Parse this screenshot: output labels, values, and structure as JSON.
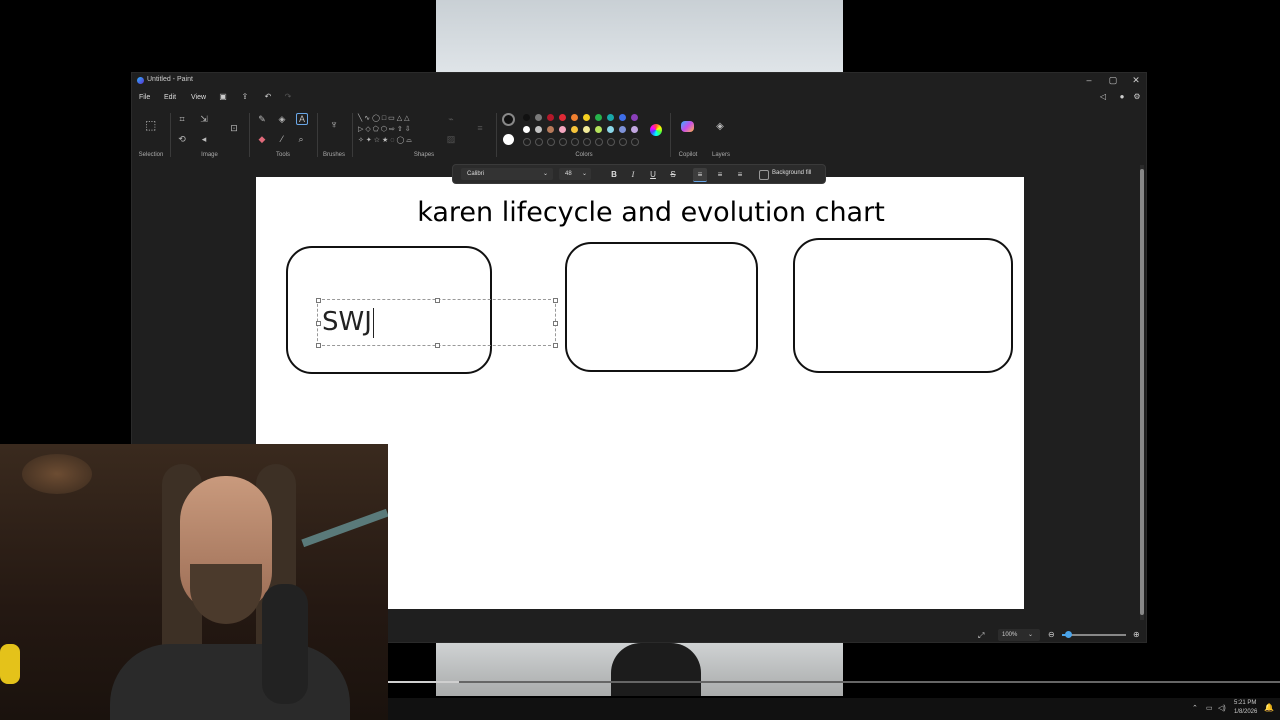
{
  "window": {
    "title": "Untitled - Paint"
  },
  "menu": {
    "items": [
      "File",
      "Edit",
      "View"
    ]
  },
  "ribbon": {
    "groups": {
      "selection": "Selection",
      "image": "Image",
      "tools": "Tools",
      "brushes": "Brushes",
      "shapes": "Shapes",
      "colors": "Colors",
      "copilot": "Copilot",
      "layers": "Layers"
    },
    "palette_row1": [
      "#111111",
      "#7a7a7a",
      "#b3182a",
      "#e02a36",
      "#f08030",
      "#f5d020",
      "#27b34b",
      "#19a7a8",
      "#3e6ee8",
      "#8a3fb9"
    ],
    "palette_row2": [
      "#ffffff",
      "#c3c3c3",
      "#b87a5a",
      "#f4a6c0",
      "#f7c43b",
      "#f2eb9a",
      "#b5e35c",
      "#8ad6e8",
      "#7e92d8",
      "#c2a7e0"
    ]
  },
  "text_toolbar": {
    "font": "Calibri",
    "size": "48",
    "bold": "B",
    "italic": "I",
    "underline": "U",
    "strike": "S",
    "background_fill": "Background fill"
  },
  "canvas": {
    "title": "karen lifecycle and evolution chart",
    "text_input": "SWJ"
  },
  "status": {
    "zoom": "100%",
    "zoom_slider_level": 0.1
  },
  "taskbar": {
    "time": "5:21 PM",
    "date": "1/8/2026"
  },
  "video": {
    "progress": 0.08
  }
}
